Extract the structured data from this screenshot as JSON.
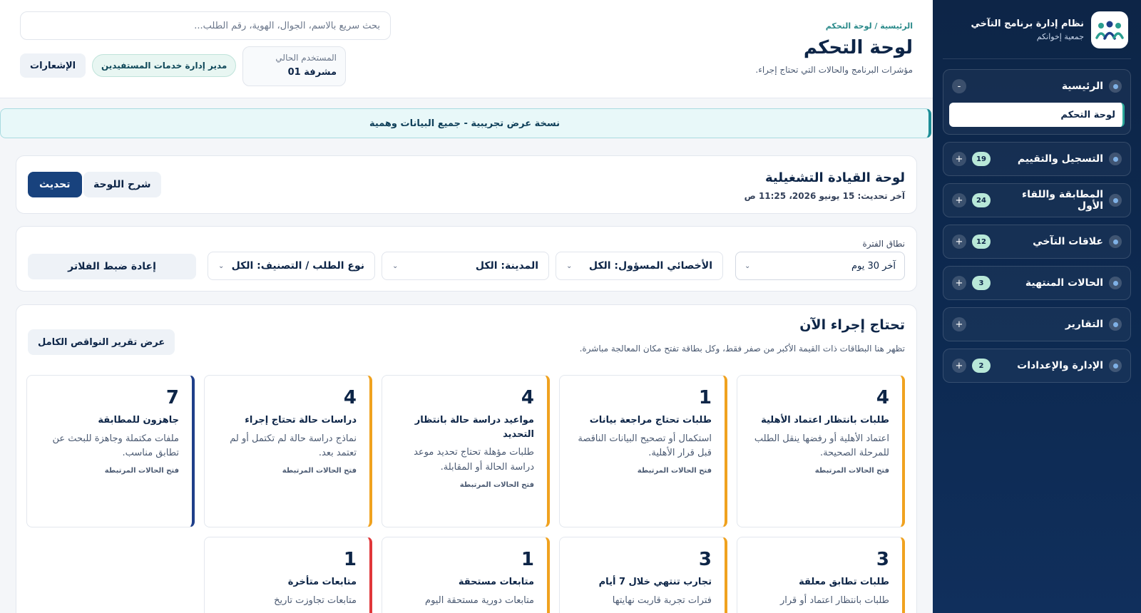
{
  "sidebar": {
    "brand_title": "نظام إدارة برنامج التآخي",
    "brand_sub": "جمعية إخوانكم",
    "groups": [
      {
        "label": "الرئيسية",
        "badge": "",
        "toggle": "-",
        "expanded": true,
        "sub_items": [
          "لوحة التحكم"
        ]
      },
      {
        "label": "التسجيل والتقييم",
        "badge": "19",
        "toggle": "+"
      },
      {
        "label": "المطابقة واللقاء الأول",
        "badge": "24",
        "toggle": "+"
      },
      {
        "label": "علاقات التآخي",
        "badge": "12",
        "toggle": "+"
      },
      {
        "label": "الحالات المنتهية",
        "badge": "3",
        "toggle": "+"
      },
      {
        "label": "التقارير",
        "badge": "",
        "toggle": "+"
      },
      {
        "label": "الإدارة والإعدادات",
        "badge": "2",
        "toggle": "+"
      }
    ]
  },
  "header": {
    "breadcrumb": "الرئيسية / لوحة التحكم",
    "title": "لوحة التحكم",
    "subtitle": "مؤشرات البرنامج والحالات التي تحتاج إجراء.",
    "search_placeholder": "بحث سريع بالاسم، الجوال، الهوية، رقم الطلب...",
    "user_label": "المستخدم الحالي",
    "user_name": "مشرفة 01",
    "role": "مدير إدارة خدمات المستفيدين",
    "notifications": "الإشعارات"
  },
  "banner": "نسخة عرض تجريبية - جميع البيانات وهمية",
  "ops": {
    "title": "لوحة القيادة التشغيلية",
    "last_update": "آخر تحديث: 15 يونيو 2026، 11:25 ص",
    "refresh": "تحديث",
    "explain": "شرح اللوحة"
  },
  "filters": {
    "period_label": "نطاق الفترة",
    "period_value": "آخر 30 يوم",
    "specialist": "الأخصائي المسؤول: الكل",
    "city": "المدينة: الكل",
    "type": "نوع الطلب / التصنيف: الكل",
    "reset": "إعادة ضبط الفلاتر"
  },
  "action": {
    "title": "تحتاج إجراء الآن",
    "subtitle": "تظهر هنا البطاقات ذات القيمة الأكبر من صفر فقط، وكل بطاقة تفتح مكان المعالجة مباشرة.",
    "report_button": "عرض تقرير النواقص الكامل",
    "cards": [
      {
        "value": "4",
        "title": "طلبات بانتظار اعتماد الأهلية",
        "desc": "اعتماد الأهلية أو رفضها ينقل الطلب للمرحلة الصحيحة.",
        "link": "فتح الحالات المرتبطة",
        "color": "orange"
      },
      {
        "value": "1",
        "title": "طلبات تحتاج مراجعة بيانات",
        "desc": "استكمال أو تصحيح البيانات الناقصة قبل قرار الأهلية.",
        "link": "فتح الحالات المرتبطة",
        "color": "orange"
      },
      {
        "value": "4",
        "title": "مواعيد دراسة حالة بانتظار التحديد",
        "desc": "طلبات مؤهلة تحتاج تحديد موعد دراسة الحالة أو المقابلة.",
        "link": "فتح الحالات المرتبطة",
        "color": "orange"
      },
      {
        "value": "4",
        "title": "دراسات حالة تحتاج إجراء",
        "desc": "نماذج دراسة حالة لم تكتمل أو لم تعتمد بعد.",
        "link": "فتح الحالات المرتبطة",
        "color": "orange"
      },
      {
        "value": "7",
        "title": "جاهزون للمطابقة",
        "desc": "ملفات مكتملة وجاهزة للبحث عن تطابق مناسب.",
        "link": "فتح الحالات المرتبطة",
        "color": "navy"
      },
      {
        "value": "3",
        "title": "طلبات تطابق معلقة",
        "desc": "طلبات بانتظار اعتماد أو قرار",
        "link": "",
        "color": "orange"
      },
      {
        "value": "3",
        "title": "تجارب تنتهي خلال 7 أيام",
        "desc": "فترات تجربة قاربت نهايتها",
        "link": "",
        "color": "orange"
      },
      {
        "value": "1",
        "title": "متابعات مستحقة",
        "desc": "متابعات دورية مستحقة اليوم",
        "link": "",
        "color": "orange"
      },
      {
        "value": "1",
        "title": "متابعات متأخرة",
        "desc": "متابعات تجاوزت تاريخ",
        "link": "",
        "color": "red"
      }
    ]
  }
}
